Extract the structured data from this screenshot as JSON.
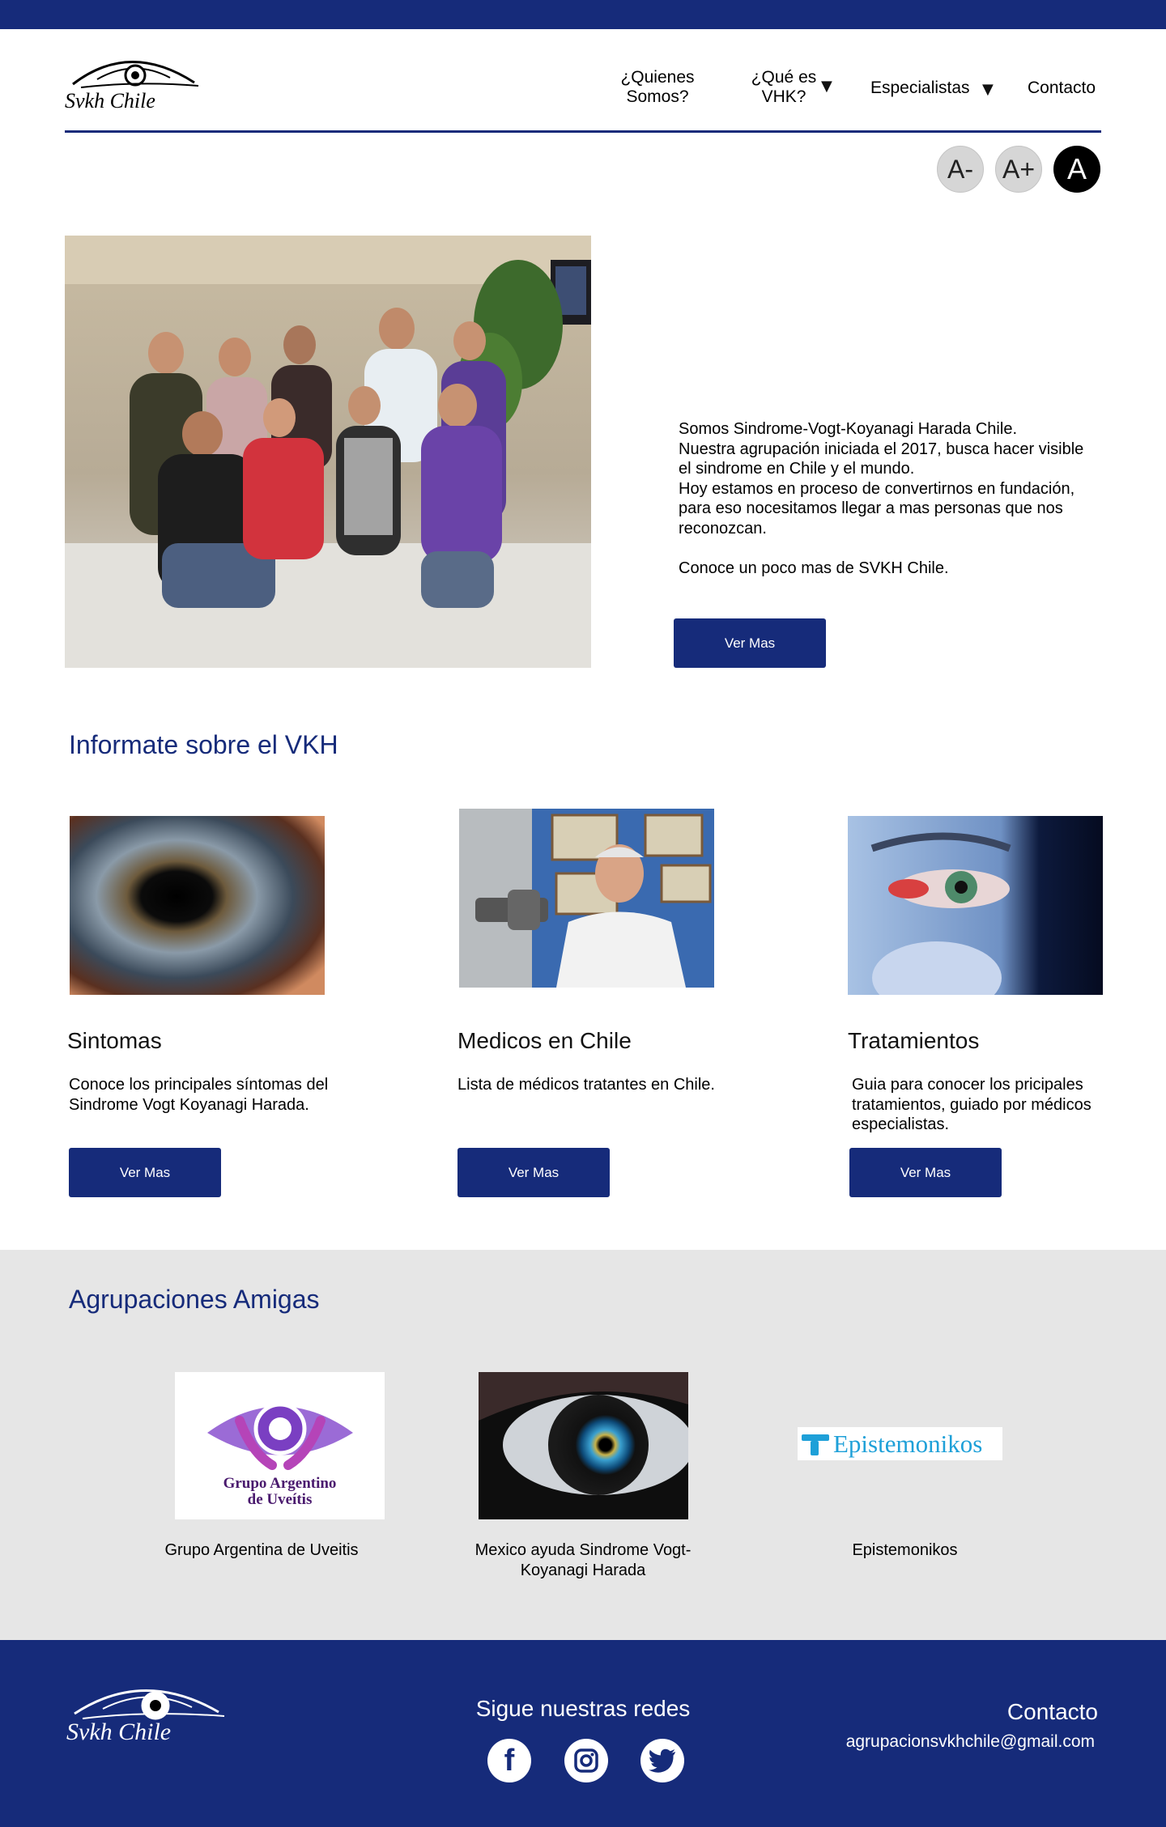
{
  "brand": {
    "name": "Svkh Chile"
  },
  "nav": {
    "items": [
      {
        "label": "¿Quienes\nSomos?"
      },
      {
        "label": "¿Qué es\nVHK?"
      },
      {
        "label": "Especialistas"
      },
      {
        "label": "Contacto"
      }
    ]
  },
  "font_controls": {
    "decrease": "A-",
    "increase": "A+",
    "contrast": "A"
  },
  "hero": {
    "paragraph1": "Somos Sindrome-Vogt-Koyanagi Harada Chile.",
    "paragraph2": "Nuestra agrupación iniciada el 2017, busca hacer visible el sindrome en Chile y el mundo.",
    "paragraph3": "Hoy estamos en proceso de convertirnos en fundación, para eso nocesitamos llegar a mas personas que nos reconozcan.",
    "paragraph4": "Conoce un poco mas de SVKH Chile.",
    "button": "Ver Mas"
  },
  "info": {
    "title": "Informate sobre el VKH",
    "cards": [
      {
        "title": "Sintomas",
        "desc": "Conoce los principales síntomas del Sindrome Vogt Koyanagi Harada.",
        "button": "Ver Mas"
      },
      {
        "title": "Medicos en Chile",
        "desc": "Lista de médicos tratantes en Chile.",
        "button": "Ver Mas"
      },
      {
        "title": "Tratamientos",
        "desc": "Guia para conocer los pricipales tratamientos, guiado por médicos especialistas.",
        "button": "Ver Mas"
      }
    ]
  },
  "friends": {
    "title": "Agrupaciones Amigas",
    "items": [
      {
        "caption": "Grupo Argentina de Uveitis",
        "logo_line1": "Grupo Argentino",
        "logo_line2": "de Uveítis"
      },
      {
        "caption": "Mexico ayuda Sindrome Vogt-Koyanagi Harada"
      },
      {
        "caption": "Epistemonikos",
        "logo_text": "Epistemonikos"
      }
    ]
  },
  "footer": {
    "social_title": "Sigue nuestras redes",
    "contact_title": "Contacto",
    "email": "agrupacionsvkhchile@gmail.com",
    "social_icons": [
      "facebook-icon",
      "instagram-icon",
      "twitter-icon"
    ]
  },
  "colors": {
    "primary": "#162b7a",
    "gray_bg": "#e6e6e6"
  }
}
